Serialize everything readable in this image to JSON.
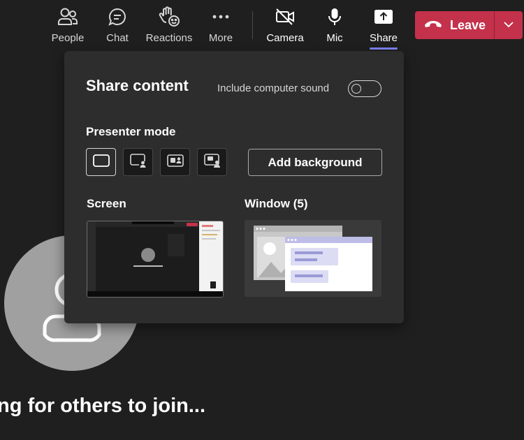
{
  "toolbar": {
    "people_label": "People",
    "chat_label": "Chat",
    "reactions_label": "Reactions",
    "more_label": "More",
    "camera_label": "Camera",
    "mic_label": "Mic",
    "share_label": "Share",
    "leave_label": "Leave"
  },
  "colors": {
    "leave": "#c4314b",
    "accent": "#7f85f5",
    "panel": "#2d2d2d",
    "background": "#1f1f1f"
  },
  "share_panel": {
    "title": "Share content",
    "computer_sound_label": "Include computer sound",
    "computer_sound_on": false,
    "presenter_mode_label": "Presenter mode",
    "presenter_modes": [
      "content-only",
      "standout",
      "side-by-side",
      "reporter"
    ],
    "presenter_mode_selected": "content-only",
    "add_background_label": "Add background",
    "screen_label": "Screen",
    "window_label": "Window (5)"
  },
  "stage": {
    "waiting_text": "ng for others to join..."
  }
}
